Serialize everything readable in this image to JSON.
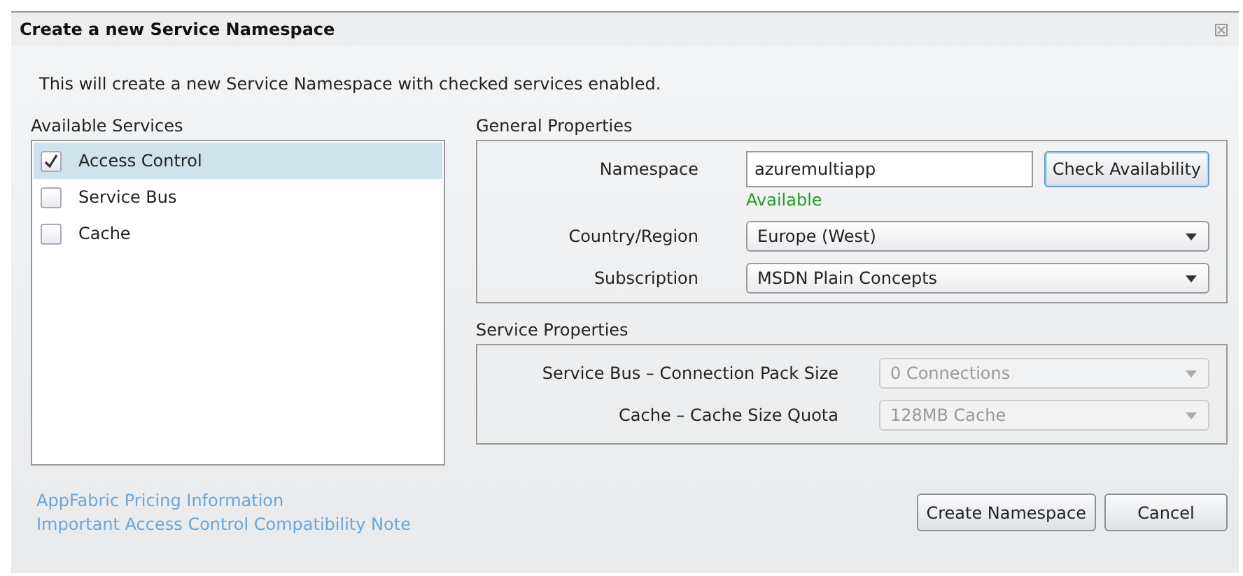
{
  "window": {
    "title": "Create a new Service Namespace"
  },
  "intro": "This will create a new Service Namespace with checked services enabled.",
  "available_services": {
    "label": "Available Services",
    "items": [
      {
        "label": "Access Control",
        "checked": true,
        "selected": true
      },
      {
        "label": "Service Bus",
        "checked": false,
        "selected": false
      },
      {
        "label": "Cache",
        "checked": false,
        "selected": false
      }
    ]
  },
  "general_properties": {
    "label": "General Properties",
    "namespace_label": "Namespace",
    "namespace_value": "azuremultiapp",
    "check_button": "Check Availability",
    "availability": "Available",
    "fields": [
      {
        "label": "Country/Region",
        "value": "Europe (West)",
        "disabled": false
      },
      {
        "label": "Subscription",
        "value": "MSDN Plain Concepts",
        "disabled": false
      }
    ]
  },
  "service_properties": {
    "label": "Service Properties",
    "fields": [
      {
        "label": "Service Bus – Connection Pack Size",
        "value": "0 Connections",
        "disabled": true
      },
      {
        "label": "Cache – Cache Size Quota",
        "value": "128MB Cache",
        "disabled": true
      }
    ]
  },
  "links": [
    "AppFabric Pricing Information",
    "Important Access Control Compatibility Note"
  ],
  "buttons": [
    "Create Namespace",
    "Cancel"
  ]
}
